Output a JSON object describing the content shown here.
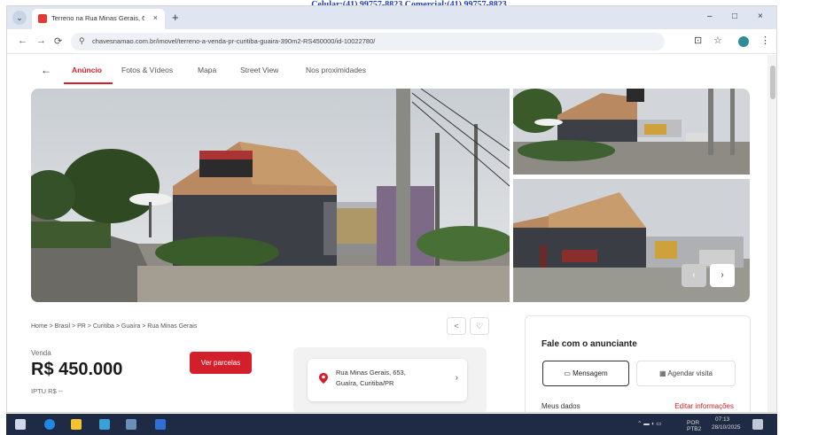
{
  "top_strip": {
    "text": "Celular:(41) 99757-8823  Comercial:(41) 99757-8823"
  },
  "browser": {
    "tab_title": "Terreno na Rua Minas Gerais, 6...",
    "tab_close": "×",
    "new_tab": "+",
    "url": "chavesnamao.com.br/imovel/terreno-a-venda-pr-curitiba-guaira-390m2-RS450000/id-10022780/",
    "window_controls": [
      "–",
      "□",
      "×"
    ],
    "nav": {
      "back": "←",
      "forward": "→",
      "reload": "⟳"
    }
  },
  "subnav": {
    "back_arrow": "←",
    "items": [
      "Anúncio",
      "Fotos & Vídeos",
      "Mapa",
      "Street View",
      "Nos proximidades"
    ]
  },
  "gallery": {
    "prev": "‹",
    "next": "›"
  },
  "breadcrumb": "Home  >  Brasil  >  PR  >  Curitiba  >  Guaíra  >  Rua Minas Gerais",
  "listing": {
    "sale_label": "Venda",
    "price": "R$ 450.000",
    "iptu": "IPTU R$ --",
    "installments_button": "Ver parcelas"
  },
  "address": {
    "line1": "Rua Minas Gerais, 653,",
    "line2": "Guaíra, Curitiba/PR",
    "chevron": "›"
  },
  "contact": {
    "title": "Fale com o anunciante",
    "message_button": "Mensagem",
    "visit_button": "Agendar visita",
    "my_data": "Meus dados",
    "edit_info": "Editar informações"
  },
  "icons": {
    "share": "share-icon",
    "favorite": "heart-icon",
    "location": "map-pin-icon"
  },
  "colors": {
    "accent": "#d21f2b",
    "tab_bar": "#dfe6f2",
    "taskbar": "#1f2a44"
  },
  "taskbar": {
    "tray_lang": "POR PTB2",
    "time": "07:13",
    "date": "28/10/2025"
  }
}
